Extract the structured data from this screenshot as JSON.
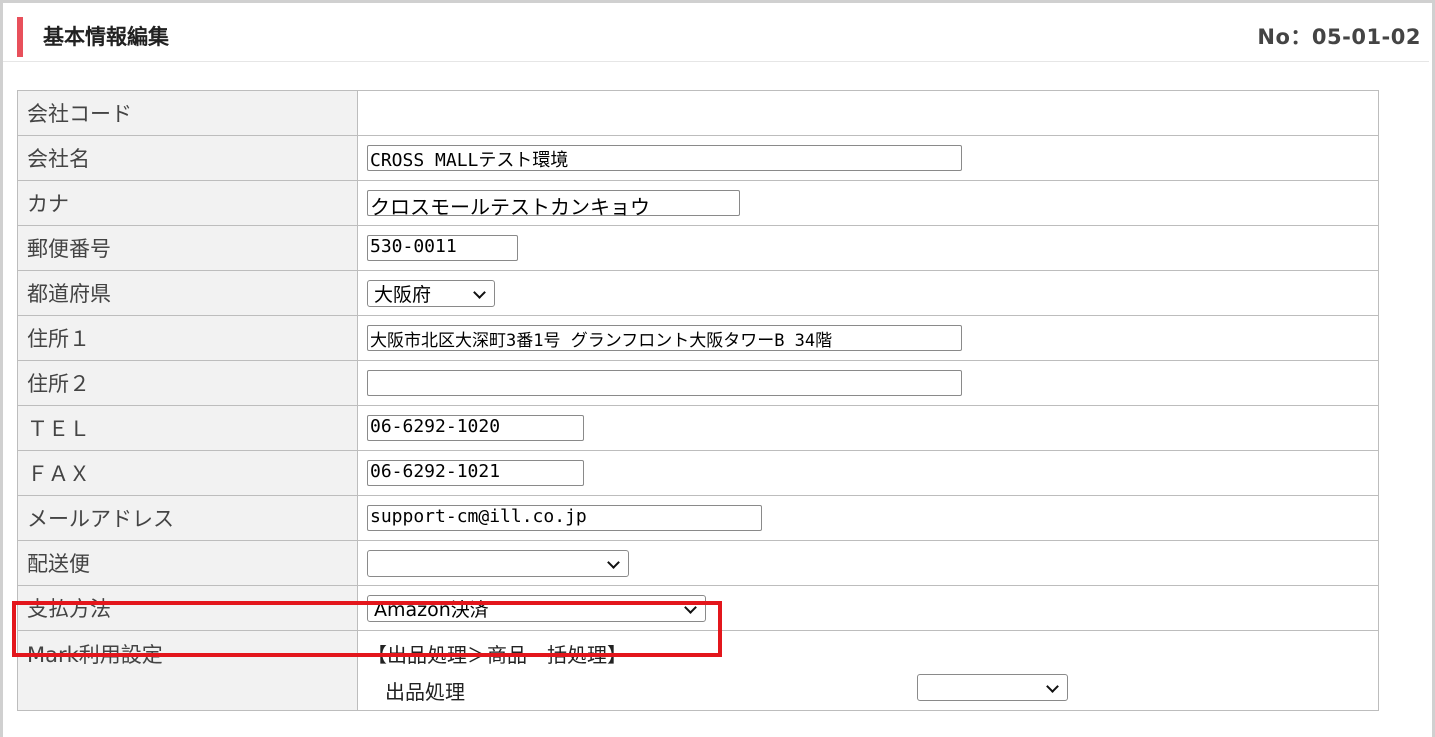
{
  "header": {
    "title": "基本情報編集",
    "page_no": "No：05-01-02"
  },
  "fields": {
    "company_code": {
      "label": "会社コード",
      "value": ""
    },
    "company_name": {
      "label": "会社名",
      "value": "CROSS MALLテスト環境"
    },
    "kana": {
      "label": "カナ",
      "value": "クロスモールテストカンキョウ"
    },
    "postal_code": {
      "label": "郵便番号",
      "value": "530-0011"
    },
    "prefecture": {
      "label": "都道府県",
      "value": "大阪府"
    },
    "address1": {
      "label": "住所１",
      "value": "大阪市北区大深町3番1号 グランフロント大阪タワーB 34階"
    },
    "address2": {
      "label": "住所２",
      "value": ""
    },
    "tel": {
      "label": "ＴＥＬ",
      "value": "06-6292-1020"
    },
    "fax": {
      "label": "ＦＡＸ",
      "value": "06-6292-1021"
    },
    "email": {
      "label": "メールアドレス",
      "value": "support-cm@ill.co.jp"
    },
    "delivery": {
      "label": "配送便",
      "value": ""
    },
    "payment": {
      "label": "支払方法",
      "value": "Amazon決済"
    },
    "mark": {
      "label": "Mark利用設定",
      "section_title": "【出品処理＞商品一括処理】",
      "row_label": "出品処理",
      "row_value": ""
    }
  },
  "colors": {
    "accent_bar": "#e8505b",
    "highlight_box": "#e3161c",
    "label_bg": "#f2f2f2"
  },
  "icons": {
    "dropdown": "chevron-down-icon"
  }
}
